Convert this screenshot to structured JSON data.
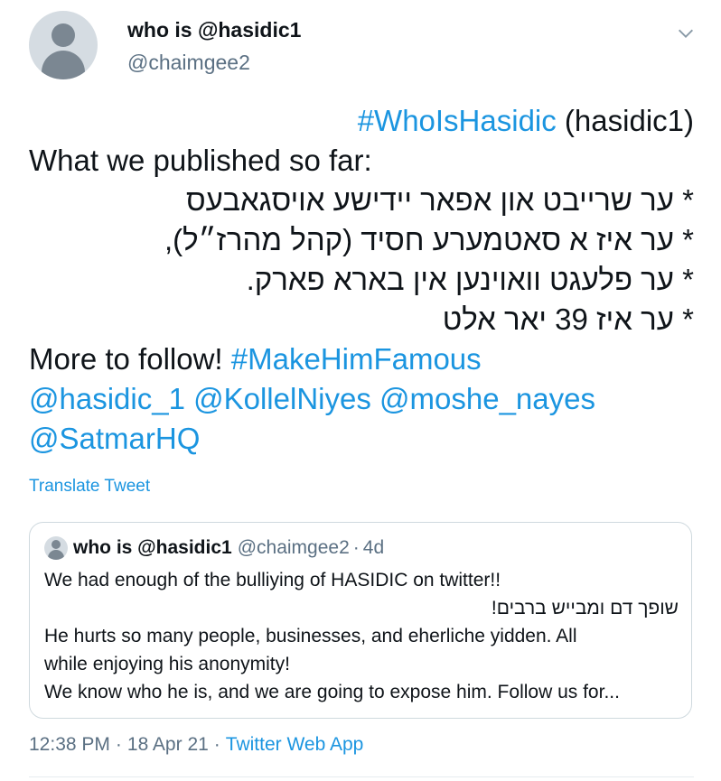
{
  "author": {
    "name": "who is @hasidic1",
    "handle": "@chaimgee2"
  },
  "tweet": {
    "line1_hashtag": "#WhoIsHasidic",
    "line1_text": " (hasidic1)",
    "line2": "What we published so far:",
    "line3": "* ער שרייבט און אפאר יידישע אויסגאבעס",
    "line4": "* ער איז א סאטמערע חסיד (קהל מהרז״ל),",
    "line5": "* ער פלעגט וואוינען אין בארא פארק.",
    "line6": "* ער איז 39 יאר אלט",
    "line7_text": "More to follow! ",
    "line7_hashtag": "#MakeHimFamous",
    "mention1": "@hasidic_1",
    "mention2": "@KollelNiyes",
    "mention3": "@moshe_nayes",
    "mention4": "@SatmarHQ"
  },
  "translate_label": "Translate Tweet",
  "quote": {
    "name": "who is @hasidic1",
    "handle": "@chaimgee2",
    "dot": "·",
    "time": "4d",
    "line1": "We had enough of the bulliying of HASIDIC on twitter!!",
    "line2": "שופך דם ומבייש ברבים!",
    "line3": "He hurts so many people, businesses, and eherliche yidden. All",
    "line4": "while enjoying his anonymity!",
    "line5": "We know who he is, and we are going to expose him. Follow us for..."
  },
  "meta": {
    "time": "12:38 PM",
    "sep1": "·",
    "date": "18 Apr 21",
    "sep2": "·",
    "source": "Twitter Web App"
  },
  "colors": {
    "link": "#1b95e0",
    "text": "#0f1419",
    "secondary": "#5b7083",
    "border": "#cfd9de"
  },
  "icons": {
    "avatar": "default-avatar-icon",
    "caret": "chevron-down-icon"
  }
}
